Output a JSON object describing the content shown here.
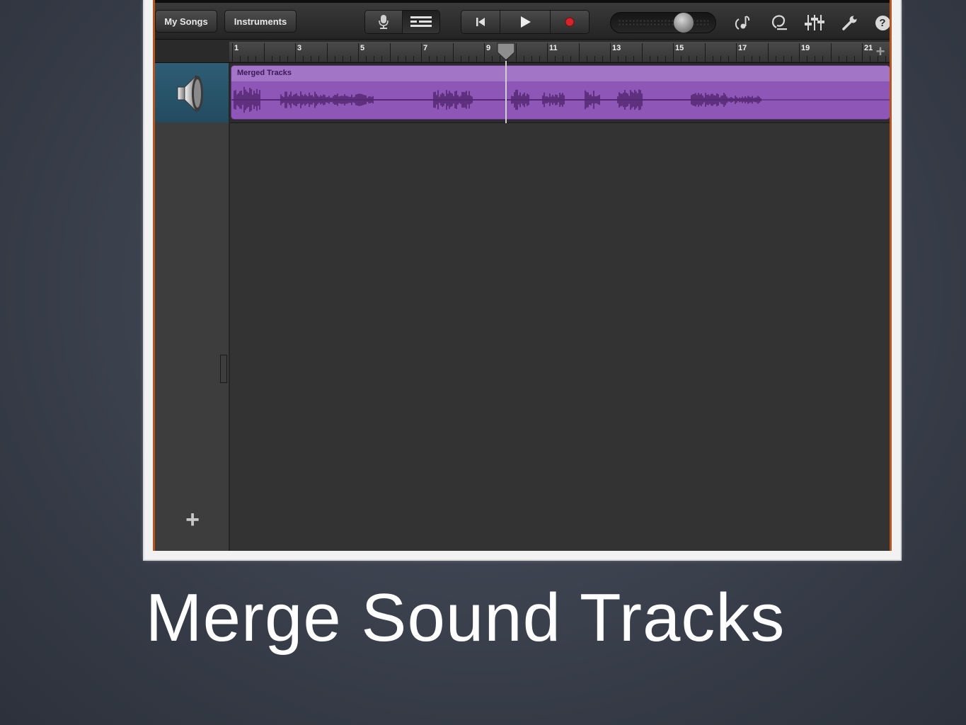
{
  "toolbar": {
    "my_songs_label": "My Songs",
    "instruments_label": "Instruments",
    "icons": [
      "microphone-icon",
      "tracks-view-icon",
      "rewind-icon",
      "play-icon",
      "record-icon",
      "note-settings-icon",
      "loop-browser-icon",
      "mixer-icon",
      "settings-wrench-icon",
      "help-icon"
    ],
    "help_label": "?",
    "master_volume": 0.7
  },
  "ruler": {
    "bar_numbers": [
      "1",
      "3",
      "5",
      "7",
      "9",
      "11",
      "13",
      "15",
      "17",
      "19",
      "21"
    ],
    "add_marker_label": "+"
  },
  "tracks": [
    {
      "instrument_icon": "speaker-icon",
      "region_name": "Merged Tracks",
      "region_color": "#8e56b6"
    }
  ],
  "playhead_bar": 9.6,
  "add_track_label": "+",
  "slide": {
    "title": "Merge Sound Tracks"
  }
}
